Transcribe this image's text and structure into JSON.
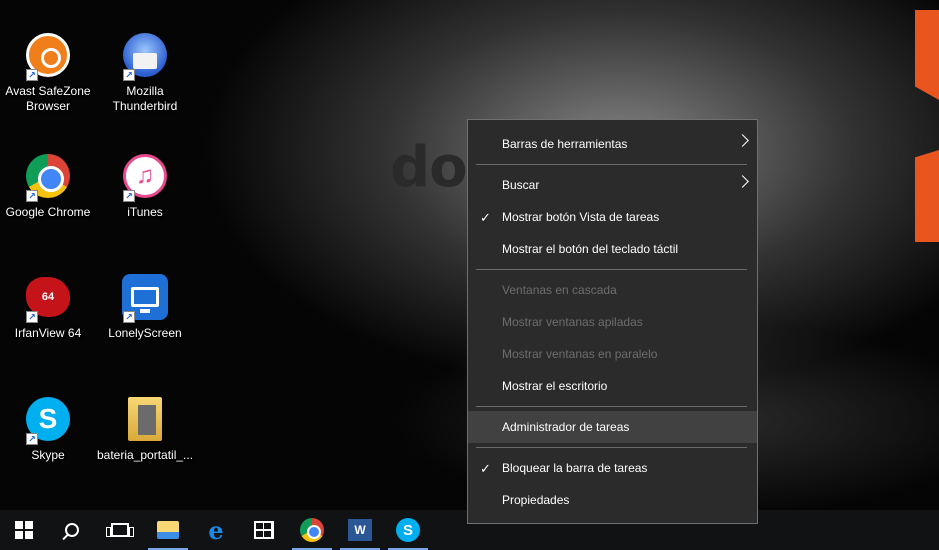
{
  "wallpaper": {
    "logo_text": "do    rce"
  },
  "desktop_icons": [
    {
      "label": "Avast SafeZone\nBrowser",
      "icon": "avast-safezone-icon"
    },
    {
      "label": "Mozilla\nThunderbird",
      "icon": "thunderbird-icon"
    },
    {
      "label": "Google Chrome",
      "icon": "chrome-icon"
    },
    {
      "label": "iTunes",
      "icon": "itunes-icon"
    },
    {
      "label": "IrfanView 64",
      "icon": "irfanview-icon",
      "badge": "64"
    },
    {
      "label": "LonelyScreen",
      "icon": "lonelyscreen-icon"
    },
    {
      "label": "Skype",
      "icon": "skype-icon",
      "glyph": "S"
    },
    {
      "label": "bateria_portatil_...",
      "icon": "folder-icon"
    }
  ],
  "taskbar": {
    "items": [
      {
        "name": "start",
        "icon": "windows-logo-icon"
      },
      {
        "name": "search",
        "icon": "search-icon"
      },
      {
        "name": "task-view",
        "icon": "task-view-icon"
      },
      {
        "name": "file-explorer",
        "icon": "file-explorer-icon",
        "running": true
      },
      {
        "name": "edge",
        "icon": "edge-icon",
        "glyph": "e"
      },
      {
        "name": "store",
        "icon": "store-icon"
      },
      {
        "name": "chrome",
        "icon": "chrome-icon",
        "running": true
      },
      {
        "name": "word",
        "icon": "word-icon",
        "glyph": "W",
        "running": true
      },
      {
        "name": "skype",
        "icon": "skype-icon",
        "glyph": "S",
        "running": true
      }
    ]
  },
  "context_menu": {
    "items": [
      {
        "label": "Barras de herramientas",
        "submenu": true
      },
      {
        "separator": true
      },
      {
        "label": "Buscar",
        "submenu": true
      },
      {
        "label": "Mostrar botón Vista de tareas",
        "checked": true
      },
      {
        "label": "Mostrar el botón del teclado táctil"
      },
      {
        "separator": true
      },
      {
        "label": "Ventanas en cascada",
        "disabled": true
      },
      {
        "label": "Mostrar ventanas apiladas",
        "disabled": true
      },
      {
        "label": "Mostrar ventanas en paralelo",
        "disabled": true
      },
      {
        "label": "Mostrar el escritorio"
      },
      {
        "separator": true
      },
      {
        "label": "Administrador de tareas",
        "highlighted": true
      },
      {
        "separator": true
      },
      {
        "label": "Bloquear la barra de tareas",
        "checked": true
      },
      {
        "label": "Propiedades"
      }
    ],
    "check_glyph": "✓"
  },
  "colors": {
    "menu_bg": "#2b2b2b",
    "menu_highlight": "#414141",
    "menu_disabled_text": "#6d6d6d",
    "taskbar_bg": "#111214",
    "accent_orange": "#e8551e"
  }
}
